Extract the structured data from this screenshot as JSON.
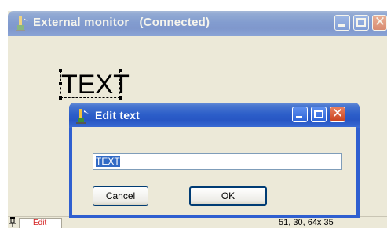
{
  "main_window": {
    "title": "External monitor   (Connected)",
    "canvas_text": "TEXT"
  },
  "status_bar": {
    "tab_label": "Edit",
    "coordinates": "51, 30, 64x 35"
  },
  "dialog": {
    "title": "Edit text",
    "input_value": "TEXT",
    "cancel_label": "Cancel",
    "ok_label": "OK"
  },
  "colors": {
    "title_bar": "#2d5fc9",
    "close_button": "#c8411d",
    "selection_highlight": "#316ac5",
    "tab_text": "#d42020"
  },
  "icons": [
    "app-icon",
    "minimize-icon",
    "maximize-icon",
    "close-icon",
    "pin-icon"
  ]
}
